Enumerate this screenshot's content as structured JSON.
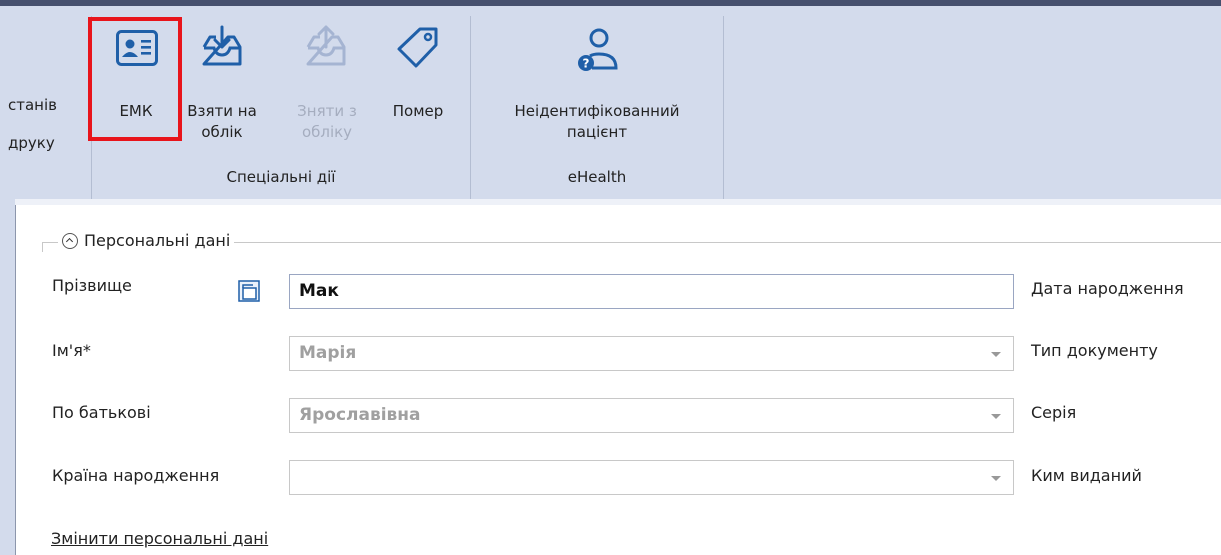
{
  "ribbon": {
    "left_labels": [
      "станів",
      "друку"
    ],
    "buttons": {
      "emk": "ЕМК",
      "take_line1": "Взяти на",
      "take_line2": "облік",
      "remove_line1": "Зняти з",
      "remove_line2": "обліку",
      "mark": "Помер",
      "unidentified_line1": "Неідентифікованний",
      "unidentified_line2": "пацієнт"
    },
    "groups": {
      "special": "Спеціальні дії",
      "ehealth": "eHealth"
    },
    "icons": {
      "emk": "id-card-icon",
      "take": "inbox-download-icon",
      "remove": "inbox-upload-icon",
      "mark": "tag-icon",
      "unidentified": "user-question-icon"
    },
    "highlight_color": "#e8141b"
  },
  "personal": {
    "section_title": "Персональні дані",
    "fields": {
      "surname_label": "Прізвище",
      "surname_value": "Мак",
      "name_label": "Ім'я*",
      "name_value": "Марія",
      "patronymic_label": "По батькові",
      "patronymic_value": "Ярославівна",
      "country_label": "Країна народження",
      "country_value": ""
    },
    "right_labels": {
      "birth_date": "Дата народження",
      "doc_type": "Тип документу",
      "series": "Серія",
      "issued_by": "Ким виданий"
    },
    "change_link": "Змінити персональні дані"
  }
}
